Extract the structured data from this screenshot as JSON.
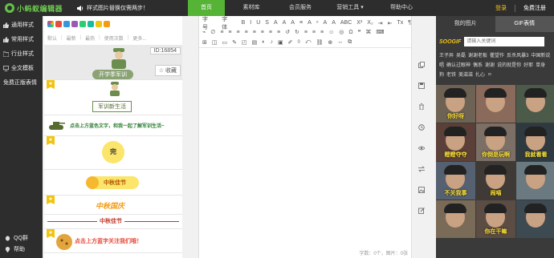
{
  "app": {
    "logo_text": "小蚂蚁编辑器"
  },
  "notice": {
    "text": "样式图片替换仅需两步！"
  },
  "nav": {
    "items": [
      {
        "label": "首页",
        "active": true
      },
      {
        "label": "素材库",
        "active": false
      },
      {
        "label": "会员服务",
        "active": false
      },
      {
        "label": "营销工具 ▾",
        "active": false
      },
      {
        "label": "帮助中心",
        "active": false
      }
    ]
  },
  "user": {
    "login": "登录",
    "register": "免费注册"
  },
  "sidebar": {
    "items": [
      {
        "label": "通用样式",
        "icon": "thumb-up-icon"
      },
      {
        "label": "常用样式",
        "icon": "thumb-up-icon"
      },
      {
        "label": "行业样式",
        "icon": "folder-icon"
      },
      {
        "label": "全文模板",
        "icon": "monitor-icon"
      },
      {
        "label": "免费正版表情",
        "icon": ""
      }
    ],
    "qq_group": "QQ群",
    "help": "帮助"
  },
  "styles": {
    "swatch_colors": [
      "#e74c3c",
      "#3498db",
      "#9b59b6",
      "#2ecc71",
      "#1abc9c",
      "#f1c40f",
      "#f39c12"
    ],
    "filters": [
      "默认",
      "最新",
      "最热",
      "使用次数",
      "更多..."
    ],
    "card1": {
      "id": "ID:16854",
      "collect": "☆ 收藏",
      "caption": "开学季军训"
    },
    "card2": {
      "caption": "军训新生活"
    },
    "card3": {
      "text": "点击上方蓝色文字，和我一起了解军训生活~"
    },
    "card4": {
      "text": "完"
    },
    "card5": {
      "text": "中秋佳节"
    },
    "card6": {
      "text": "中秋国庆"
    },
    "card7": {
      "text": "中秋佳节"
    },
    "card8": {
      "text": "点击上方蓝字关注我们哦！"
    }
  },
  "editor": {
    "row1": [
      "字号",
      "字体",
      "B",
      "I",
      "U",
      "S",
      "A",
      "A",
      "A",
      "≡",
      "A",
      "⁰",
      "A",
      "A",
      "ABC",
      "X²",
      "X₂",
      "⇥",
      "⇤",
      "Tx",
      "¶"
    ],
    "row2": [
      "⌁",
      "∅",
      "≡",
      "≡",
      "≡",
      "≡",
      "≡",
      "≡",
      "≡",
      "≡",
      "↺",
      "↻",
      "≡",
      "≡",
      "≡",
      "☺",
      "◎",
      "Ω",
      "❝",
      "⌘",
      "⌨"
    ],
    "row3": [
      "⊞",
      "◫",
      "▭",
      "✎",
      "◰",
      "▤",
      "◐",
      "♪",
      "▣",
      "✐",
      "◊",
      "⤺",
      "⛓",
      "⊕",
      "↔",
      "⧉"
    ],
    "status": "字数：0个，图片：0张"
  },
  "right": {
    "tabs": [
      {
        "label": "我的图片",
        "active": false
      },
      {
        "label": "GIF表情",
        "active": true
      }
    ],
    "gif_logo": "SOOGIF",
    "search_placeholder": "请输入关键词",
    "keywords": [
      "王子异",
      "吴磊",
      "谢谢老板",
      "瞿望作",
      "反杀风暴3",
      "中国新说唱",
      "确认过眼神",
      "偶系",
      "谢谢",
      "说的就是你",
      "好耶",
      "单身狗",
      "老铁",
      "美滋滋",
      "扎心",
      "ㅇ"
    ],
    "gif_captions": [
      "你好呀",
      "",
      "",
      "瞪瞪夺夺",
      "你倒是玩啊",
      "我就看看",
      "不关我事",
      "闹喵",
      "",
      "",
      "你在干嘛",
      ""
    ]
  }
}
